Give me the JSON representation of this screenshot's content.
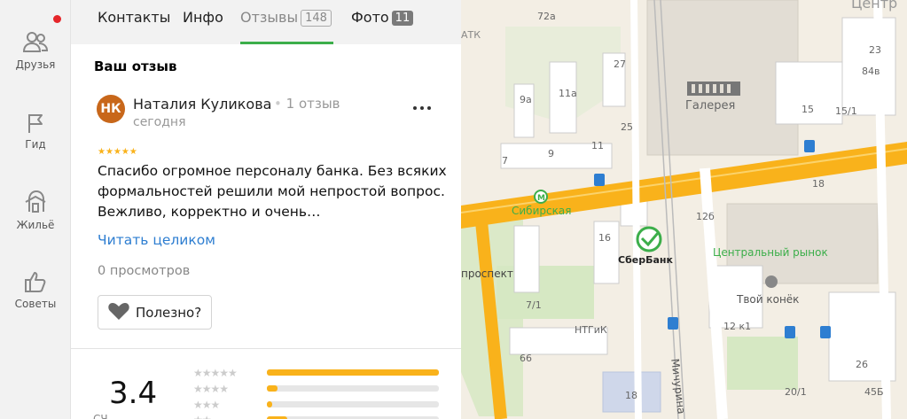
{
  "sidebar": {
    "items": [
      {
        "label": "Друзья",
        "icon": "friends-icon"
      },
      {
        "label": "Гид",
        "icon": "flag-icon"
      },
      {
        "label": "Жильё",
        "icon": "home-icon"
      },
      {
        "label": "Советы",
        "icon": "thumbs-up-icon"
      }
    ]
  },
  "tabs": [
    {
      "label": "Контакты"
    },
    {
      "label": "Инфо"
    },
    {
      "label": "Отзывы",
      "count": "148"
    },
    {
      "label": "Фото",
      "count": "11"
    }
  ],
  "review": {
    "section_title": "Ваш отзыв",
    "avatar_initials": "НК",
    "author": "Наталия Куликова",
    "author_meta": "1 отзыв",
    "date": "сегодня",
    "stars": "★★★★★",
    "text": "Спасибо огромное персоналу банка. Без всяких формальностей решили мой непростой вопрос. Вежливо, корректно и очень…",
    "read_more": "Читать целиком",
    "views": "0 просмотров",
    "useful_label": "Полезно?"
  },
  "rating": {
    "value": "3.4",
    "count_text": "СЧ",
    "distribution": [
      {
        "stars": "★★★★★",
        "fraction": 1.0
      },
      {
        "stars": "★★★★",
        "fraction": 0.06
      },
      {
        "stars": "★★★",
        "fraction": 0.03
      },
      {
        "stars": "★★",
        "fraction": 0.12
      }
    ]
  },
  "map": {
    "labels": {
      "city_center": "Центр",
      "atk": "АТК",
      "galereya": "Галерея",
      "sibirskaya": "Сибирская",
      "sberbank": "СберБанк",
      "central_market": "Центральный рынок",
      "tvoy_konek": "Твой конёк",
      "prospekt": "проспект",
      "ntgik": "НТГиК",
      "michurina": "Мичурина"
    },
    "house_numbers": {
      "n72a": "72а",
      "n27": "27",
      "n23": "23",
      "n84v": "84в",
      "n9a": "9а",
      "n11a": "11а",
      "n15": "15",
      "n15_1": "15/1",
      "n25": "25",
      "n7": "7",
      "n9": "9",
      "n11": "11",
      "n18a": "18",
      "n12b": "12б",
      "n16": "16",
      "n7_1": "7/1",
      "n12k1": "12 к1",
      "n66": "66",
      "n26": "26",
      "n18b": "18",
      "n20_1": "20/1",
      "n45b": "45Б"
    },
    "colors": {
      "road": "#f9b21b",
      "metro": "#3cae4a",
      "bus": "#2e7ed1"
    }
  }
}
